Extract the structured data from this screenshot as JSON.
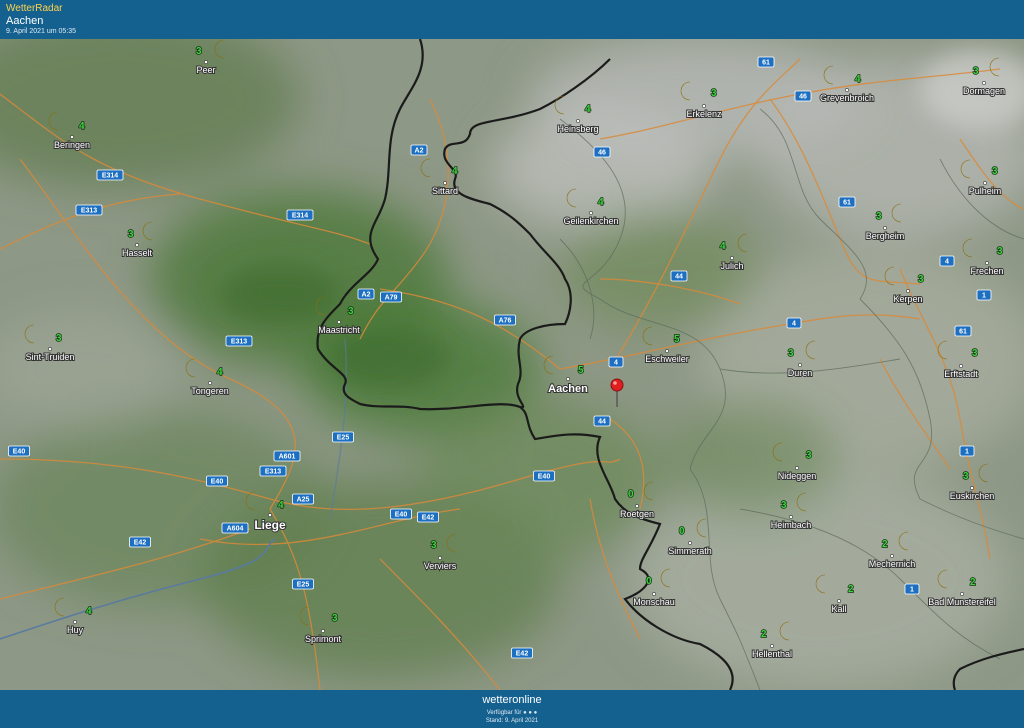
{
  "header": {
    "app_name": "WetterRadar",
    "location": "Aachen",
    "timestamp": "9. April 2021 um 05:35"
  },
  "footer": {
    "brand": "wetteronline",
    "available": "Verfügbar für ● ● ●",
    "stand": "Stand: 9. April 2021"
  },
  "colors": {
    "bar": "#14618f",
    "moon": "#f2cf3a",
    "temp": "#3fd43f",
    "border": "#1b1b1b",
    "road": "#d98a3a",
    "sign": "#1d6fc2"
  },
  "cities": [
    {
      "name": "Peer",
      "temp": "3"
    },
    {
      "name": "Beringen",
      "temp": "4"
    },
    {
      "name": "Hasselt",
      "temp": "3"
    },
    {
      "name": "Sint-Truiden",
      "temp": "3"
    },
    {
      "name": "Tongeren",
      "temp": "4"
    },
    {
      "name": "Maastricht",
      "temp": "3"
    },
    {
      "name": "Sittard",
      "temp": "4"
    },
    {
      "name": "Heinsberg",
      "temp": "4"
    },
    {
      "name": "Erkelenz",
      "temp": "3"
    },
    {
      "name": "Grevenbroich",
      "temp": "4"
    },
    {
      "name": "Dormagen",
      "temp": "3"
    },
    {
      "name": "Pulheim",
      "temp": "3"
    },
    {
      "name": "Geilenkirchen",
      "temp": "4"
    },
    {
      "name": "Bergheim",
      "temp": "3"
    },
    {
      "name": "Julich",
      "temp": "4"
    },
    {
      "name": "Frechen",
      "temp": "3"
    },
    {
      "name": "Kerpen",
      "temp": "3"
    },
    {
      "name": "Eschweiler",
      "temp": "5"
    },
    {
      "name": "Aachen",
      "temp": "5"
    },
    {
      "name": "Duren",
      "temp": "3"
    },
    {
      "name": "Erftstadt",
      "temp": "3"
    },
    {
      "name": "Liege",
      "temp": "4"
    },
    {
      "name": "Verviers",
      "temp": "3"
    },
    {
      "name": "Roetgen",
      "temp": "0"
    },
    {
      "name": "Simmerath",
      "temp": "0"
    },
    {
      "name": "Monschau",
      "temp": "0"
    },
    {
      "name": "Nideggen",
      "temp": "3"
    },
    {
      "name": "Heimbach",
      "temp": "3"
    },
    {
      "name": "Euskirchen",
      "temp": "3"
    },
    {
      "name": "Mechernich",
      "temp": "2"
    },
    {
      "name": "Kall",
      "temp": "2"
    },
    {
      "name": "Bad Munstereifel",
      "temp": "2"
    },
    {
      "name": "Hellenthal",
      "temp": "2"
    },
    {
      "name": "Huy",
      "temp": "4"
    },
    {
      "name": "Sprimont",
      "temp": "3"
    }
  ],
  "roads": [
    "61",
    "46",
    "46",
    "A2",
    "E314",
    "E313",
    "E314",
    "A2",
    "A79",
    "A76",
    "E313",
    "4",
    "44",
    "61",
    "4",
    "4",
    "1",
    "61",
    "44",
    "E25",
    "A601",
    "E313",
    "E40",
    "E40",
    "A25",
    "A604",
    "E42",
    "E40",
    "E42",
    "E40",
    "1",
    "1",
    "E25",
    "E42"
  ]
}
